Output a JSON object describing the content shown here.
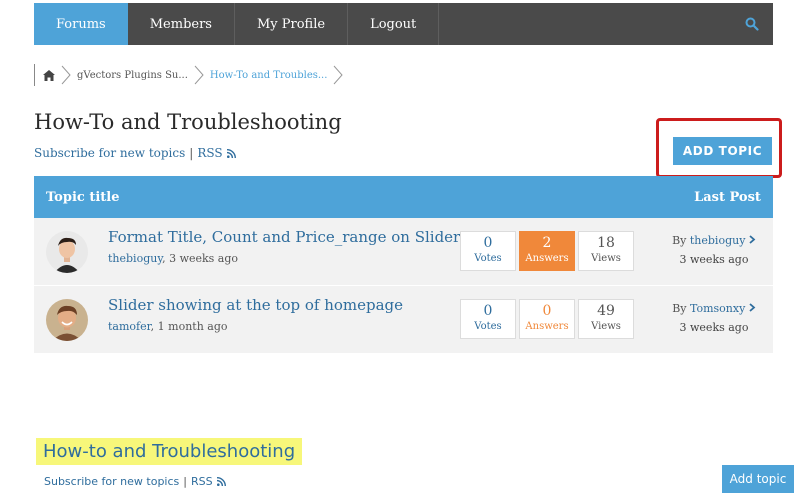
{
  "nav": {
    "items": [
      "Forums",
      "Members",
      "My Profile",
      "Logout"
    ],
    "active_color": "#4ea3d8",
    "bar_color": "#4a4a4a"
  },
  "breadcrumb": {
    "home_icon": "home-icon",
    "items": [
      "gVectors Plugins Su...",
      "How-To and Troubles..."
    ]
  },
  "forum": {
    "title": "How-To and Troubleshooting",
    "subscribe_label": "Subscribe for new topics",
    "rss_label": "RSS",
    "add_topic_label": "ADD TOPIC"
  },
  "table": {
    "header_title": "Topic title",
    "header_last": "Last Post",
    "rows": [
      {
        "title": "Format Title, Count and Price_range on Slider?",
        "author": "thebioguy",
        "age": ", 3 weeks ago",
        "votes": "0",
        "votes_label": "Votes",
        "answers": "2",
        "answers_label": "Answers",
        "views": "18",
        "views_label": "Views",
        "by": "By",
        "last_user": "thebioguy",
        "last_time": "3 weeks ago"
      },
      {
        "title": "Slider showing at the top of homepage",
        "author": "tamofer",
        "age": ", 1 month ago",
        "votes": "0",
        "votes_label": "Votes",
        "answers": "0",
        "answers_label": "Answers",
        "views": "49",
        "views_label": "Views",
        "by": "By",
        "last_user": "Tomsonxy",
        "last_time": "3 weeks ago"
      }
    ]
  },
  "bottom": {
    "title": "How-to and Troubleshooting",
    "subscribe_label": "Subscribe for new topics",
    "rss_label": "RSS",
    "add_topic_label": "Add topic"
  }
}
